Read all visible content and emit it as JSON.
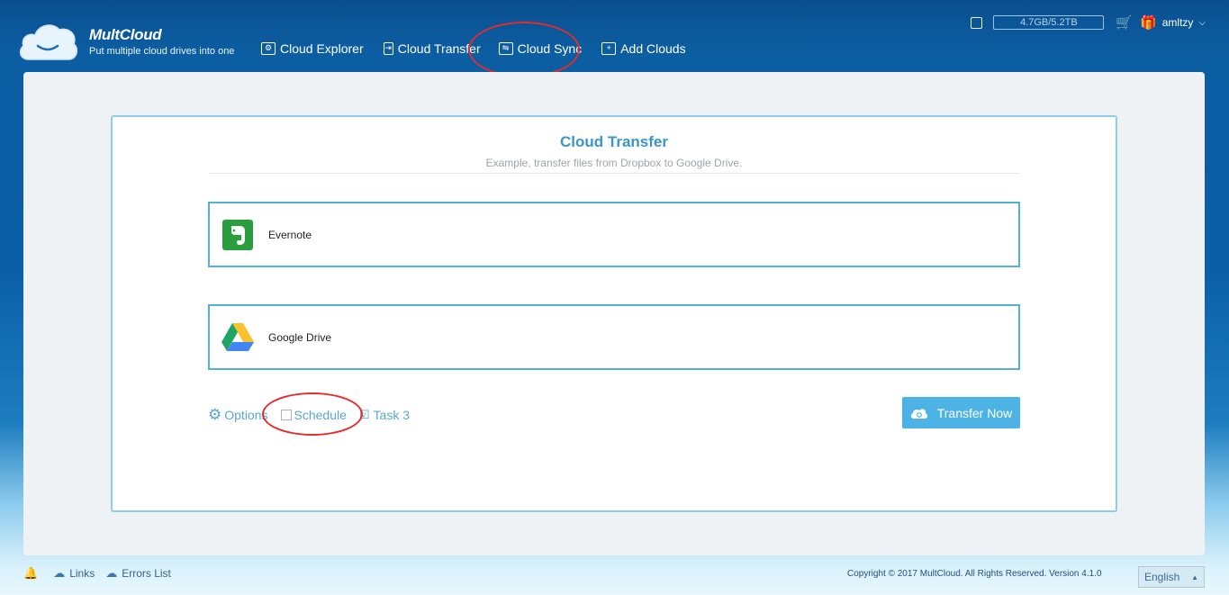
{
  "app": {
    "name": "MultCloud",
    "tagline": "Put multiple cloud drives into one"
  },
  "nav": {
    "cloud_explorer": "Cloud Explorer",
    "cloud_transfer": "Cloud Transfer",
    "cloud_sync": "Cloud Sync",
    "add_clouds": "Add Clouds"
  },
  "account": {
    "storage": "4.7GB/5.2TB",
    "username": "amltzy"
  },
  "transfer": {
    "title": "Cloud Transfer",
    "subtitle": "Example, transfer files from Dropbox to Google Drive.",
    "source_name": "Evernote",
    "destination_name": "Google Drive",
    "options_label": "Options",
    "schedule_label": "Schedule",
    "task_label": "Task 3",
    "transfer_button": "Transfer Now"
  },
  "footer": {
    "links": "Links",
    "errors_list": "Errors List",
    "copyright": "Copyright © 2017 MultCloud. All Rights Reserved. Version 4.1.0",
    "language": "English"
  },
  "colors": {
    "accent": "#4cb3e4",
    "title": "#3b95c9",
    "annotation": "#e32c2c"
  }
}
